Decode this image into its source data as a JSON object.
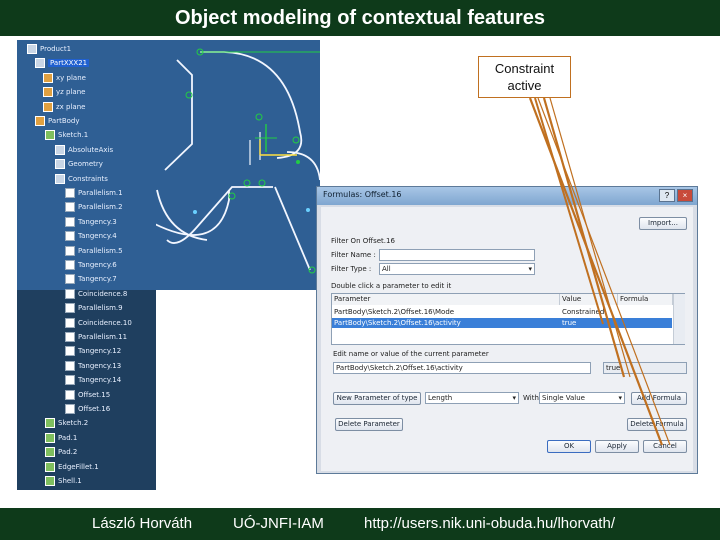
{
  "slide": {
    "title": "Object modeling of contextual features",
    "callout": [
      "Constraint",
      "active"
    ],
    "footer": {
      "author": "László Horváth",
      "affiliation": "UÓ-JNFI-IAM",
      "url": "http://users.nik.uni-obuda.hu/lhorvath/"
    }
  },
  "sketch": {
    "dimension_label": "160",
    "accent": "#22cc44"
  },
  "tree": {
    "items": [
      {
        "label": "Product1",
        "icon": "product-icon"
      },
      {
        "label": "PartXXX21",
        "icon": "part-icon"
      },
      {
        "label": "xy plane",
        "icon": "plane-icon"
      },
      {
        "label": "yz plane",
        "icon": "plane-icon"
      },
      {
        "label": "zx plane",
        "icon": "plane-icon"
      },
      {
        "label": "PartBody",
        "icon": "body-icon"
      },
      {
        "label": "Sketch.1",
        "icon": "sketch-icon"
      },
      {
        "label": "AbsoluteAxis",
        "icon": "axis-icon"
      },
      {
        "label": "Geometry",
        "icon": "geometry-icon"
      },
      {
        "label": "Constraints",
        "icon": "constraints-icon"
      },
      {
        "label": "Parallelism.1",
        "icon": "constraint-icon"
      },
      {
        "label": "Parallelism.2",
        "icon": "constraint-icon"
      },
      {
        "label": "Tangency.3",
        "icon": "constraint-icon"
      },
      {
        "label": "Tangency.4",
        "icon": "constraint-icon"
      },
      {
        "label": "Parallelism.5",
        "icon": "constraint-icon"
      },
      {
        "label": "Tangency.6",
        "icon": "constraint-icon"
      },
      {
        "label": "Tangency.7",
        "icon": "constraint-icon"
      },
      {
        "label": "Coincidence.8",
        "icon": "constraint-icon"
      },
      {
        "label": "Parallelism.9",
        "icon": "constraint-icon"
      },
      {
        "label": "Coincidence.10",
        "icon": "constraint-icon"
      },
      {
        "label": "Parallelism.11",
        "icon": "constraint-icon"
      },
      {
        "label": "Tangency.12",
        "icon": "constraint-icon"
      },
      {
        "label": "Tangency.13",
        "icon": "constraint-icon"
      },
      {
        "label": "Tangency.14",
        "icon": "constraint-icon"
      },
      {
        "label": "Offset.15",
        "icon": "constraint-icon"
      },
      {
        "label": "Offset.16",
        "icon": "constraint-icon"
      },
      {
        "label": "Sketch.2",
        "icon": "sketch-icon"
      },
      {
        "label": "Pad.1",
        "icon": "pad-icon"
      },
      {
        "label": "Pad.2",
        "icon": "pad-icon"
      },
      {
        "label": "EdgeFillet.1",
        "icon": "fillet-icon"
      },
      {
        "label": "Shell.1",
        "icon": "shell-icon"
      }
    ]
  },
  "dialog": {
    "title": "Formulas: Offset.16",
    "import_label": "Import...",
    "filter_on_label": "Filter On Offset.16",
    "filter_name_label": "Filter Name :",
    "filter_name_value": "",
    "filter_type_label": "Filter Type :",
    "filter_type_value": "All",
    "double_click_hint": "Double click a parameter to edit it",
    "columns": [
      "Parameter",
      "Value",
      "Formula"
    ],
    "rows": [
      {
        "parameter": "PartBody\\Sketch.2\\Offset.16\\Mode",
        "value": "Constrained",
        "formula": ""
      },
      {
        "parameter": "PartBody\\Sketch.2\\Offset.16\\activity",
        "value": "true",
        "formula": ""
      }
    ],
    "edit_label": "Edit name or value of the current parameter",
    "edit_name": "PartBody\\Sketch.2\\Offset.16\\activity",
    "edit_value": "true",
    "new_param_button": "New Parameter of type",
    "new_param_type": "Length",
    "with_label": "With",
    "with_value": "Single Value",
    "add_formula_button": "Add Formula",
    "delete_param_button": "Delete Parameter",
    "delete_formula_button": "Delete Formula",
    "ok_label": "OK",
    "apply_label": "Apply",
    "cancel_label": "Cancel"
  }
}
